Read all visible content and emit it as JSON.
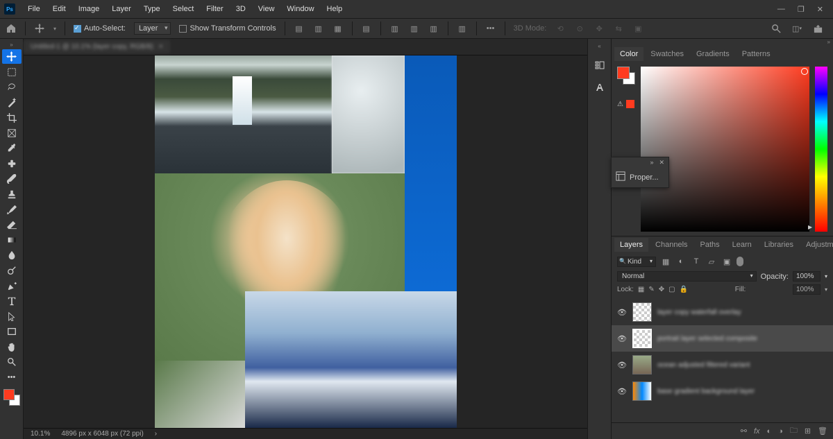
{
  "menu": {
    "items": [
      "File",
      "Edit",
      "Image",
      "Layer",
      "Type",
      "Select",
      "Filter",
      "3D",
      "View",
      "Window",
      "Help"
    ]
  },
  "options_bar": {
    "auto_select": "Auto-Select:",
    "auto_select_target": "Layer",
    "show_transform": "Show Transform Controls",
    "mode_3d": "3D Mode:"
  },
  "document": {
    "tab_title": "Untitled-1 @ 10.1% (layer copy, RGB/8)",
    "zoom": "10.1%",
    "dimensions": "4896 px x 6048 px (72 ppi)"
  },
  "panels": {
    "color_tabs": [
      "Color",
      "Swatches",
      "Gradients",
      "Patterns"
    ],
    "layers_tabs": [
      "Layers",
      "Channels",
      "Paths",
      "Learn",
      "Libraries",
      "Adjustments"
    ]
  },
  "properties_float": {
    "title": "Proper..."
  },
  "layers": {
    "filter_kind": "Kind",
    "blend_mode": "Normal",
    "opacity_label": "Opacity:",
    "opacity_value": "100%",
    "lock_label": "Lock:",
    "fill_label": "Fill:",
    "fill_value": "100%",
    "items": [
      {
        "name": "layer copy waterfall overlay"
      },
      {
        "name": "portrait layer selected composite"
      },
      {
        "name": "ocean adjusted filtered variant"
      },
      {
        "name": "base gradient background layer"
      }
    ]
  },
  "foreground_color": "#ff3b1f",
  "background_color": "#ffffff"
}
